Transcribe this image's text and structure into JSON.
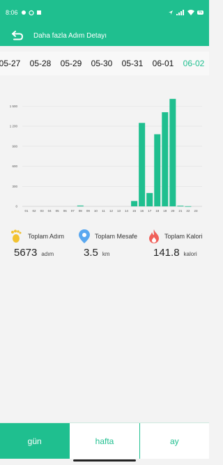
{
  "status_bar": {
    "time": "8:06",
    "battery": "%"
  },
  "app_bar": {
    "title": "Daha fazla Adım Detayı"
  },
  "dates": [
    "05-27",
    "05-28",
    "05-29",
    "05-30",
    "05-31",
    "06-01",
    "06-02"
  ],
  "active_date_index": 6,
  "chart_data": {
    "type": "bar",
    "categories": [
      "01",
      "02",
      "03",
      "04",
      "05",
      "06",
      "07",
      "08",
      "09",
      "10",
      "11",
      "12",
      "13",
      "14",
      "15",
      "16",
      "17",
      "18",
      "19",
      "20",
      "21",
      "22",
      "23"
    ],
    "values": [
      0,
      0,
      0,
      0,
      0,
      0,
      0,
      12,
      0,
      0,
      0,
      0,
      0,
      0,
      80,
      1250,
      200,
      1080,
      1410,
      1610,
      10,
      2,
      0
    ],
    "yticks": [
      0,
      300,
      600,
      900,
      1200,
      1500
    ],
    "ytick_labels": [
      "0",
      "300",
      "600",
      "900",
      "1 200",
      "1 500"
    ],
    "ylim": [
      0,
      1650
    ],
    "grid": true,
    "bar_color": "#1fbf8f"
  },
  "stats": {
    "steps": {
      "label": "Toplam Adım",
      "value": "5673",
      "unit": "adım",
      "icon": "footprints-icon"
    },
    "distance": {
      "label": "Toplam Mesafe",
      "value": "3.5",
      "unit": "km",
      "icon": "location-pin-icon"
    },
    "calories": {
      "label": "Toplam Kalori",
      "value": "141.8",
      "unit": "kalori",
      "icon": "flame-icon"
    }
  },
  "tabs": [
    {
      "label": "gün",
      "active": true
    },
    {
      "label": "hafta",
      "active": false
    },
    {
      "label": "ay",
      "active": false
    }
  ],
  "colors": {
    "accent": "#1fbf8f"
  }
}
